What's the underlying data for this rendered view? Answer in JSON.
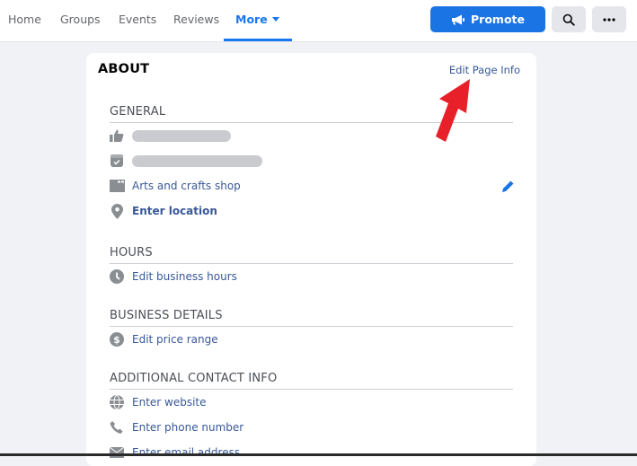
{
  "nav": {
    "tabs": [
      {
        "label": "Home"
      },
      {
        "label": "Groups"
      },
      {
        "label": "Events"
      },
      {
        "label": "Reviews"
      },
      {
        "label": "More",
        "active": true
      }
    ],
    "promote_label": "Promote",
    "search_icon": "search-icon",
    "more_icon": "ellipsis-icon"
  },
  "about": {
    "title": "ABOUT",
    "edit_link": "Edit Page Info",
    "sections": {
      "general": {
        "heading": "GENERAL",
        "category": "Arts and crafts shop",
        "location": "Enter location"
      },
      "hours": {
        "heading": "HOURS",
        "item": "Edit business hours"
      },
      "business": {
        "heading": "BUSINESS DETAILS",
        "item": "Edit price range"
      },
      "contact": {
        "heading": "ADDITIONAL CONTACT INFO",
        "website": "Enter website",
        "phone": "Enter phone number",
        "email": "Enter email address"
      }
    }
  },
  "colors": {
    "accent": "#1877f2",
    "link": "#385898",
    "annotation_arrow": "#e8202a"
  }
}
